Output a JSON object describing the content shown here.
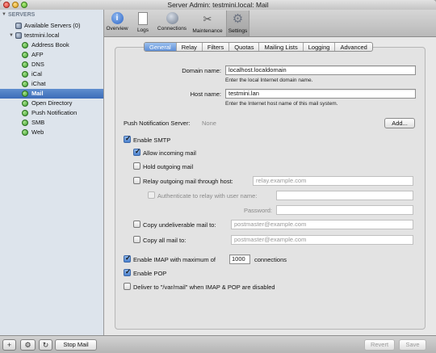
{
  "window": {
    "title": "Server Admin: testmini.local: Mail"
  },
  "sidebar": {
    "header": "SERVERS",
    "available_servers": "Available Servers (0)",
    "server_name": "testmini.local",
    "services": [
      {
        "label": "Address Book",
        "icon": "status-dot-icon",
        "selected": false
      },
      {
        "label": "AFP",
        "icon": "status-dot-icon",
        "selected": false
      },
      {
        "label": "DNS",
        "icon": "status-dot-icon",
        "selected": false
      },
      {
        "label": "iCal",
        "icon": "status-dot-icon",
        "selected": false
      },
      {
        "label": "iChat",
        "icon": "status-dot-icon",
        "selected": false
      },
      {
        "label": "Mail",
        "icon": "status-dot-icon",
        "selected": true
      },
      {
        "label": "Open Directory",
        "icon": "status-dot-icon",
        "selected": false
      },
      {
        "label": "Push Notification",
        "icon": "status-dot-icon",
        "selected": false
      },
      {
        "label": "SMB",
        "icon": "status-dot-icon",
        "selected": false
      },
      {
        "label": "Web",
        "icon": "status-dot-icon",
        "selected": false
      }
    ]
  },
  "toolbar": {
    "buttons": [
      {
        "label": "Overview",
        "icon": "info-icon"
      },
      {
        "label": "Logs",
        "icon": "document-icon"
      },
      {
        "label": "Connections",
        "icon": "globe-icon"
      },
      {
        "label": "Maintenance",
        "icon": "tools-icon"
      },
      {
        "label": "Settings",
        "icon": "gear-icon"
      }
    ],
    "active": "Settings"
  },
  "tabs": {
    "items": [
      "General",
      "Relay",
      "Filters",
      "Quotas",
      "Mailing Lists",
      "Logging",
      "Advanced"
    ],
    "selected": "General"
  },
  "general": {
    "domain_label": "Domain name:",
    "domain_value": "localhost.localdomain",
    "domain_hint": "Enter the local Internet domain name.",
    "host_label": "Host name:",
    "host_value": "testmini.lan",
    "host_hint": "Enter the Internet host name of this mail system.",
    "push_label": "Push Notification Server:",
    "push_value": "None",
    "add_button": "Add...",
    "enable_smtp": {
      "label": "Enable SMTP",
      "checked": true
    },
    "allow_incoming": {
      "label": "Allow incoming mail",
      "checked": true
    },
    "hold_outgoing": {
      "label": "Hold outgoing mail",
      "checked": false
    },
    "relay_outgoing": {
      "label": "Relay outgoing mail through host:",
      "checked": false,
      "placeholder": "relay.example.com"
    },
    "authenticate": {
      "label": "Authenticate to relay with user name:",
      "checked": false
    },
    "password_label": "Password:",
    "copy_undeliverable": {
      "label": "Copy undeliverable mail to:",
      "checked": false,
      "placeholder": "postmaster@example.com"
    },
    "copy_all": {
      "label": "Copy all mail to:",
      "checked": false,
      "placeholder": "postmaster@example.com"
    },
    "enable_imap": {
      "label": "Enable IMAP with maximum of",
      "checked": true,
      "max_connections": "1000",
      "suffix": "connections"
    },
    "enable_pop": {
      "label": "Enable POP",
      "checked": true
    },
    "deliver_var": {
      "label": "Deliver to \"/var/mail\" when IMAP & POP are disabled",
      "checked": false
    }
  },
  "bottom": {
    "add_icon": "+",
    "action_icon": "⚙",
    "refresh_icon": "↻",
    "stop_button": "Stop Mail",
    "revert_button": "Revert",
    "save_button": "Save"
  }
}
